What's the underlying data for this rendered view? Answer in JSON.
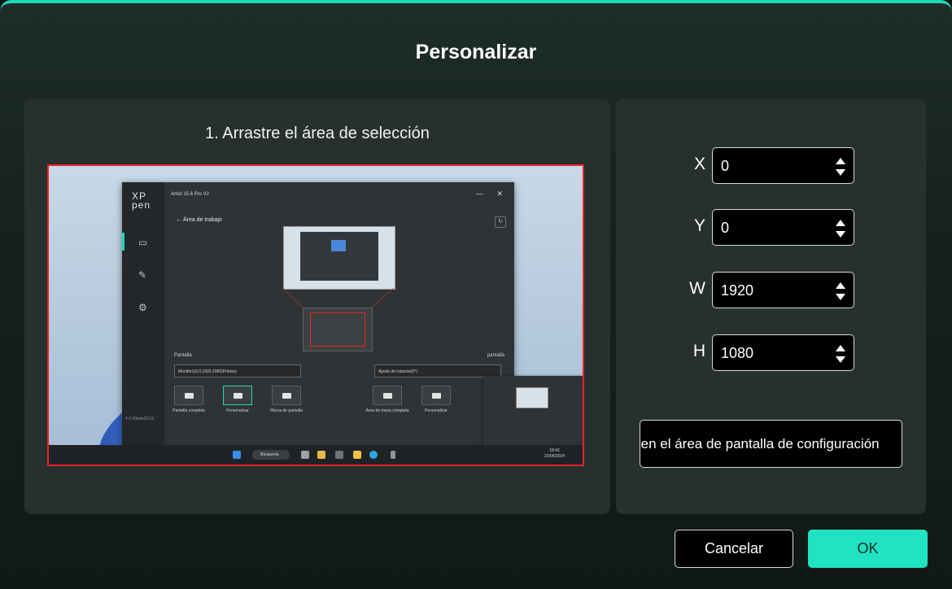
{
  "dialog": {
    "title": "Personalizar",
    "accent_color": "#1fd8b6"
  },
  "left": {
    "instruction": "1. Arrastre el área de selección"
  },
  "preview": {
    "app_logo": "XP pen",
    "app_title": "Artist 15.6 Pro V2",
    "back_label": "Área de trabajo",
    "screen_label": "Pantalla",
    "screen_label_right": "pantalla",
    "monitor_select": "Monitor1(0,0,1920,1080)Primary",
    "rotation_select": "Ajuste de rotación(0°)",
    "btn_fullscreen": "Pantalla completa",
    "btn_custom": "Personalizar",
    "btn_mark": "Marca de pantalla",
    "btn_full_area": "Área de mesa completa",
    "btn_custom2": "Personalizar",
    "version": "4.0.4(beta2010)",
    "taskbar_search": "Búsqueda",
    "taskbar_time": "18:42",
    "taskbar_date": "23/06/2024"
  },
  "fields": {
    "x": {
      "label": "X",
      "value": "0"
    },
    "y": {
      "label": "Y",
      "value": "0"
    },
    "w": {
      "label": "W",
      "value": "1920"
    },
    "h": {
      "label": "H",
      "value": "1080"
    }
  },
  "right": {
    "screen_click_label": "Haga clic en el área de pantalla de configuración"
  },
  "footer": {
    "cancel_label": "Cancelar",
    "ok_label": "OK"
  }
}
